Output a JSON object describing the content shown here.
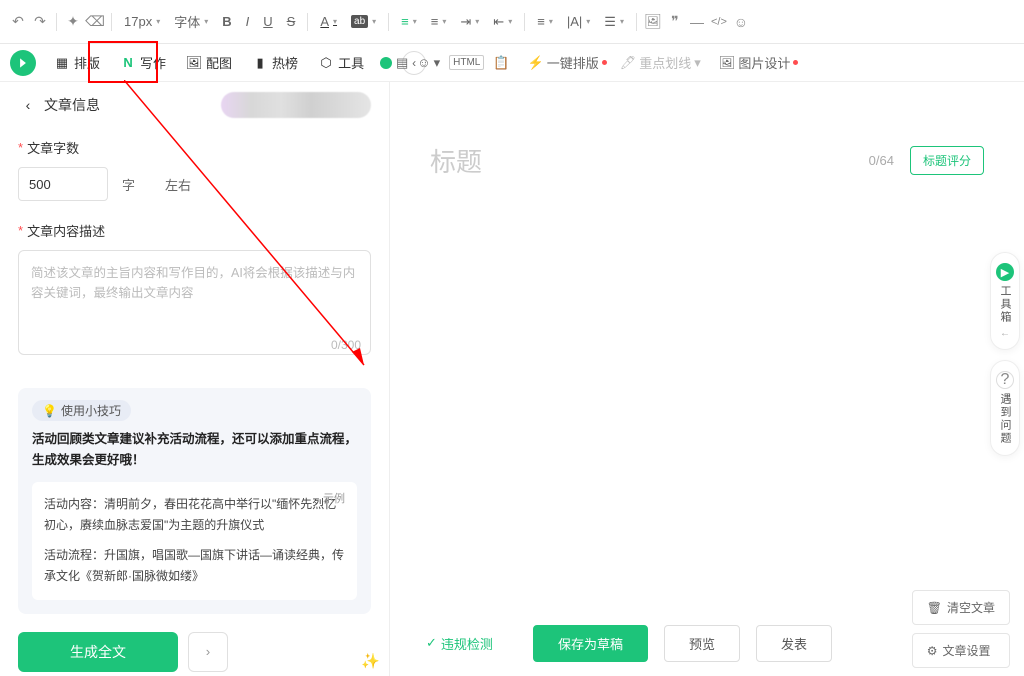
{
  "toolbar": {
    "font_size": "17px",
    "font_label": "字体",
    "bold": "B",
    "italic": "I",
    "underline": "U",
    "strikethrough": "S"
  },
  "tabs": {
    "layout": "排版",
    "write": "写作",
    "image": "配图",
    "hot": "热榜",
    "tools": "工具"
  },
  "toolbar2": {
    "auto_layout": "一键排版",
    "highlight": "重点划线",
    "image_design": "图片设计"
  },
  "sidebar": {
    "header_title": "文章信息",
    "word_count_label": "文章字数",
    "word_count_value": "500",
    "word_count_unit1": "字",
    "word_count_unit2": "左右",
    "desc_label": "文章内容描述",
    "desc_placeholder": "简述该文章的主旨内容和写作目的，AI将会根据该描述与内容关键词，最终输出文章内容",
    "desc_counter": "0/300",
    "tips_badge": "使用小技巧",
    "tips_main": "活动回顾类文章建议补充活动流程，还可以添加重点流程，生成效果会更好哦！",
    "example_label": "示例",
    "example_p1": "活动内容：清明前夕，春田花花高中举行以\"缅怀先烈忆初心，赓续血脉志爱国\"为主题的升旗仪式",
    "example_p2": "活动流程：升国旗，唱国歌—国旗下讲话—诵读经典，传承文化《贺新郎·国脉微如缕》",
    "generate_btn": "生成全文"
  },
  "editor": {
    "title_placeholder": "标题",
    "title_count": "0/64",
    "score_btn": "标题评分"
  },
  "right_bar": {
    "toolbox": "工具箱",
    "faq": "遇到问题"
  },
  "footer": {
    "check": "违规检测",
    "save_draft": "保存为草稿",
    "preview": "预览",
    "publish": "发表"
  },
  "right_actions": {
    "clear": "清空文章",
    "settings": "文章设置"
  }
}
